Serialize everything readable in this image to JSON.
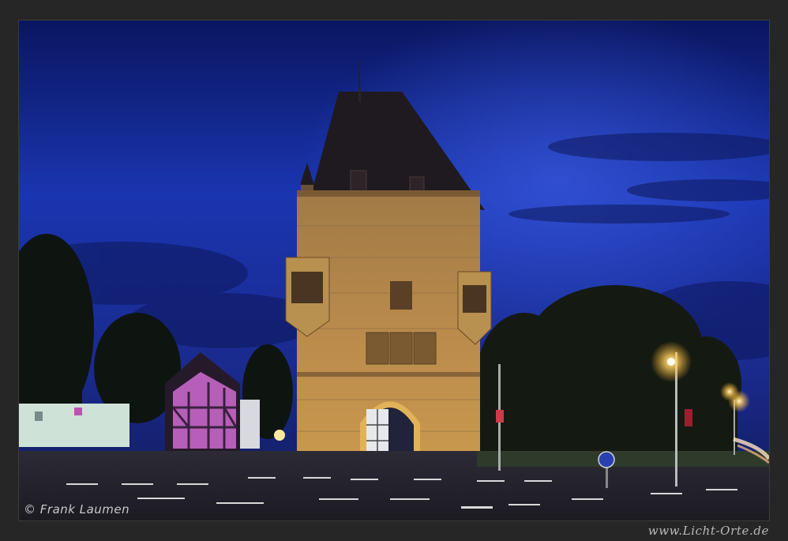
{
  "photo": {
    "copyright": "© Frank Laumen",
    "site": "www.Licht-Orte.de"
  },
  "colors": {
    "sky_top": "#0c1a6a",
    "sky_mid": "#1d38b8",
    "stone_lit": "#c8954a",
    "roof": "#221d22",
    "halftimber": "#c36fc0"
  }
}
